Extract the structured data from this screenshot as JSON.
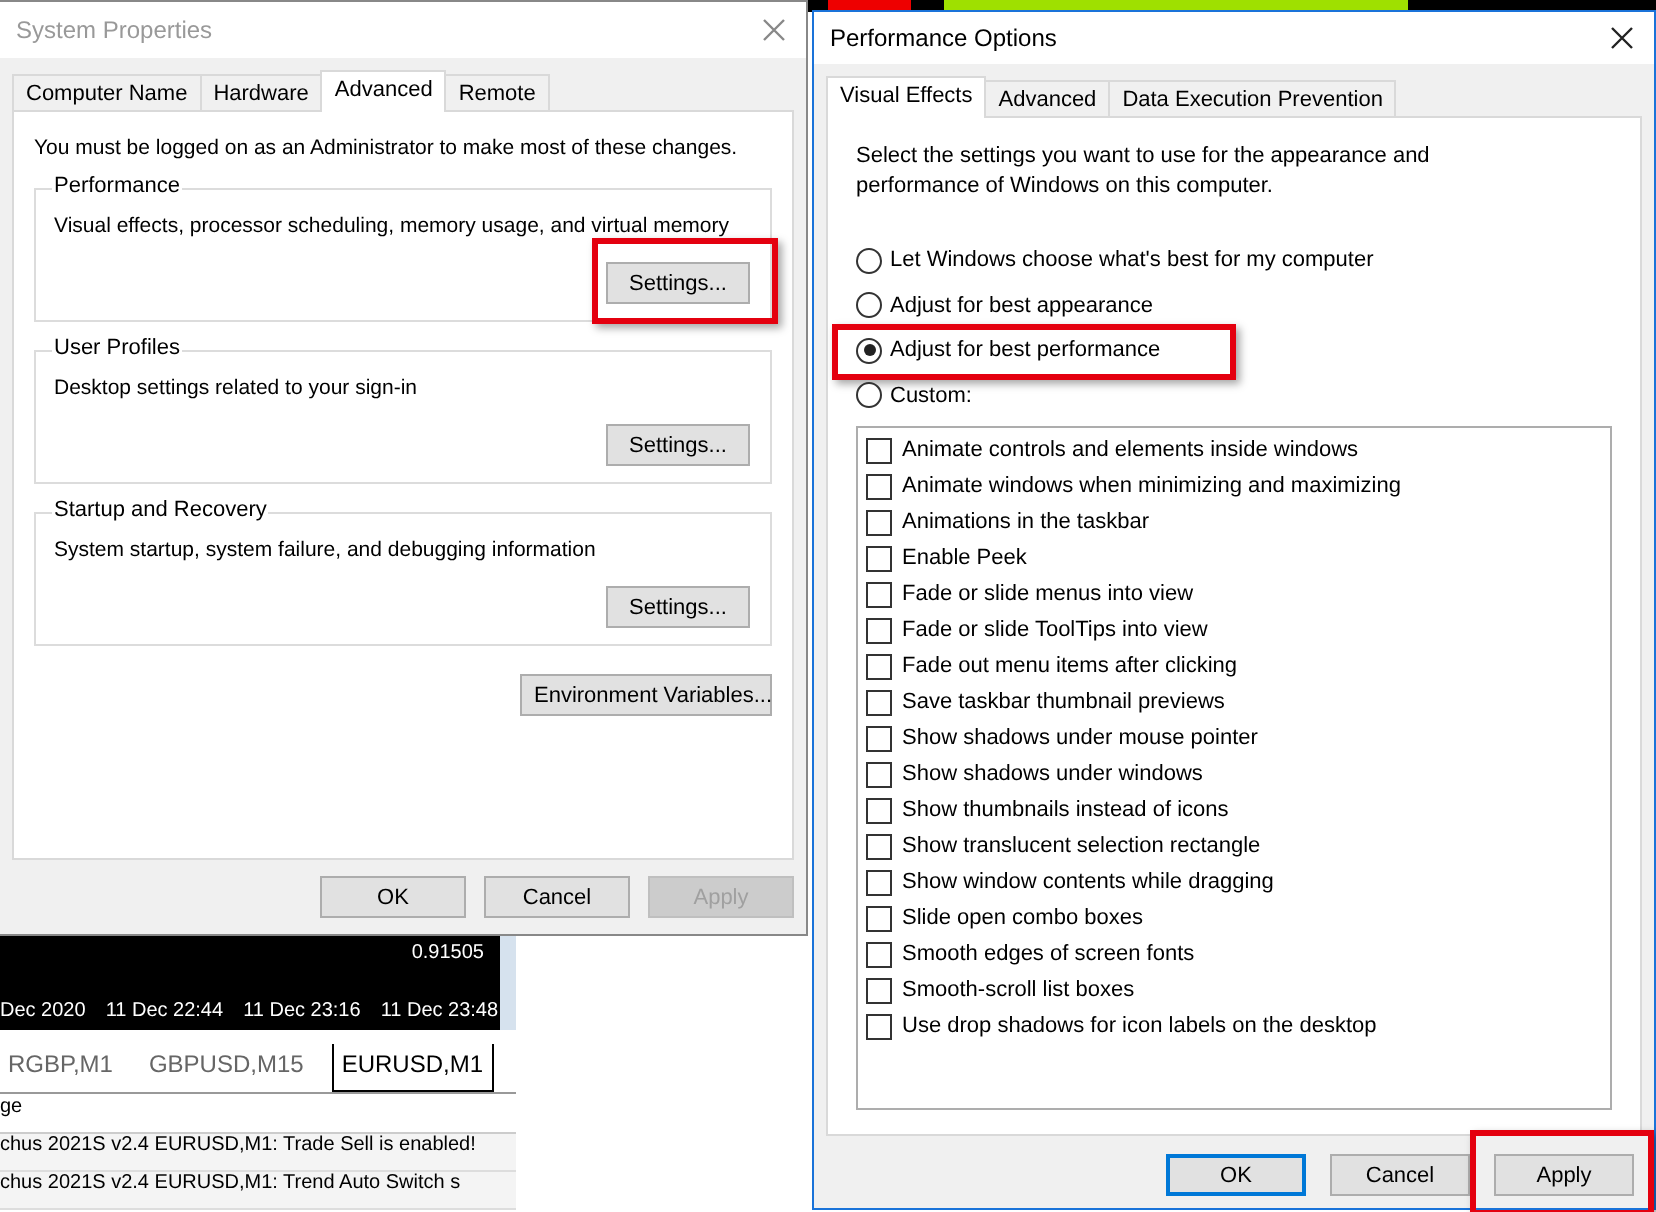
{
  "background_app": {
    "price_label": "0.91505",
    "time_labels": [
      "Dec 2020",
      "11 Dec 22:44",
      "11 Dec 23:16",
      "11 Dec 23:48"
    ],
    "chart_tabs": [
      {
        "label": "RGBP,M1",
        "selected": false
      },
      {
        "label": "GBPUSD,M15",
        "selected": false
      },
      {
        "label": "EURUSD,M1",
        "selected": true
      }
    ],
    "log_header": "ge",
    "log_lines": [
      "chus 2021S v2.4 EURUSD,M1: Trade Sell is enabled!",
      "chus 2021S v2.4 EURUSD,M1: Trend Auto Switch s"
    ]
  },
  "system_properties": {
    "title": "System Properties",
    "tabs": [
      {
        "label": "Computer Name",
        "selected": false
      },
      {
        "label": "Hardware",
        "selected": false
      },
      {
        "label": "Advanced",
        "selected": true
      },
      {
        "label": "Remote",
        "selected": false
      }
    ],
    "notice": "You must be logged on as an Administrator to make most of these changes.",
    "groups": [
      {
        "title": "Performance",
        "description": "Visual effects, processor scheduling, memory usage, and virtual memory",
        "button": "Settings...",
        "highlighted": true
      },
      {
        "title": "User Profiles",
        "description": "Desktop settings related to your sign-in",
        "button": "Settings...",
        "highlighted": false
      },
      {
        "title": "Startup and Recovery",
        "description": "System startup, system failure, and debugging information",
        "button": "Settings...",
        "highlighted": false
      }
    ],
    "environment_button": "Environment Variables...",
    "buttons": [
      {
        "label": "OK",
        "disabled": false
      },
      {
        "label": "Cancel",
        "disabled": false
      },
      {
        "label": "Apply",
        "disabled": true
      }
    ]
  },
  "performance_options": {
    "title": "Performance Options",
    "tabs": [
      {
        "label": "Visual Effects",
        "selected": true
      },
      {
        "label": "Advanced",
        "selected": false
      },
      {
        "label": "Data Execution Prevention",
        "selected": false
      }
    ],
    "description": "Select the settings you want to use for the appearance and performance of Windows on this computer.",
    "radios": [
      {
        "label": "Let Windows choose what's best for my computer",
        "selected": false,
        "highlighted": false
      },
      {
        "label": "Adjust for best appearance",
        "selected": false,
        "highlighted": false
      },
      {
        "label": "Adjust for best performance",
        "selected": true,
        "highlighted": true
      },
      {
        "label": "Custom:",
        "selected": false,
        "highlighted": false
      }
    ],
    "effects": [
      {
        "label": "Animate controls and elements inside windows",
        "checked": false
      },
      {
        "label": "Animate windows when minimizing and maximizing",
        "checked": false
      },
      {
        "label": "Animations in the taskbar",
        "checked": false
      },
      {
        "label": "Enable Peek",
        "checked": false
      },
      {
        "label": "Fade or slide menus into view",
        "checked": false
      },
      {
        "label": "Fade or slide ToolTips into view",
        "checked": false
      },
      {
        "label": "Fade out menu items after clicking",
        "checked": false
      },
      {
        "label": "Save taskbar thumbnail previews",
        "checked": false
      },
      {
        "label": "Show shadows under mouse pointer",
        "checked": false
      },
      {
        "label": "Show shadows under windows",
        "checked": false
      },
      {
        "label": "Show thumbnails instead of icons",
        "checked": false
      },
      {
        "label": "Show translucent selection rectangle",
        "checked": false
      },
      {
        "label": "Show window contents while dragging",
        "checked": false
      },
      {
        "label": "Slide open combo boxes",
        "checked": false
      },
      {
        "label": "Smooth edges of screen fonts",
        "checked": false
      },
      {
        "label": "Smooth-scroll list boxes",
        "checked": false
      },
      {
        "label": "Use drop shadows for icon labels on the desktop",
        "checked": false
      }
    ],
    "buttons": [
      {
        "label": "OK",
        "focused": true,
        "highlighted": false
      },
      {
        "label": "Cancel",
        "focused": false,
        "highlighted": false
      },
      {
        "label": "Apply",
        "focused": false,
        "highlighted": true
      }
    ]
  }
}
